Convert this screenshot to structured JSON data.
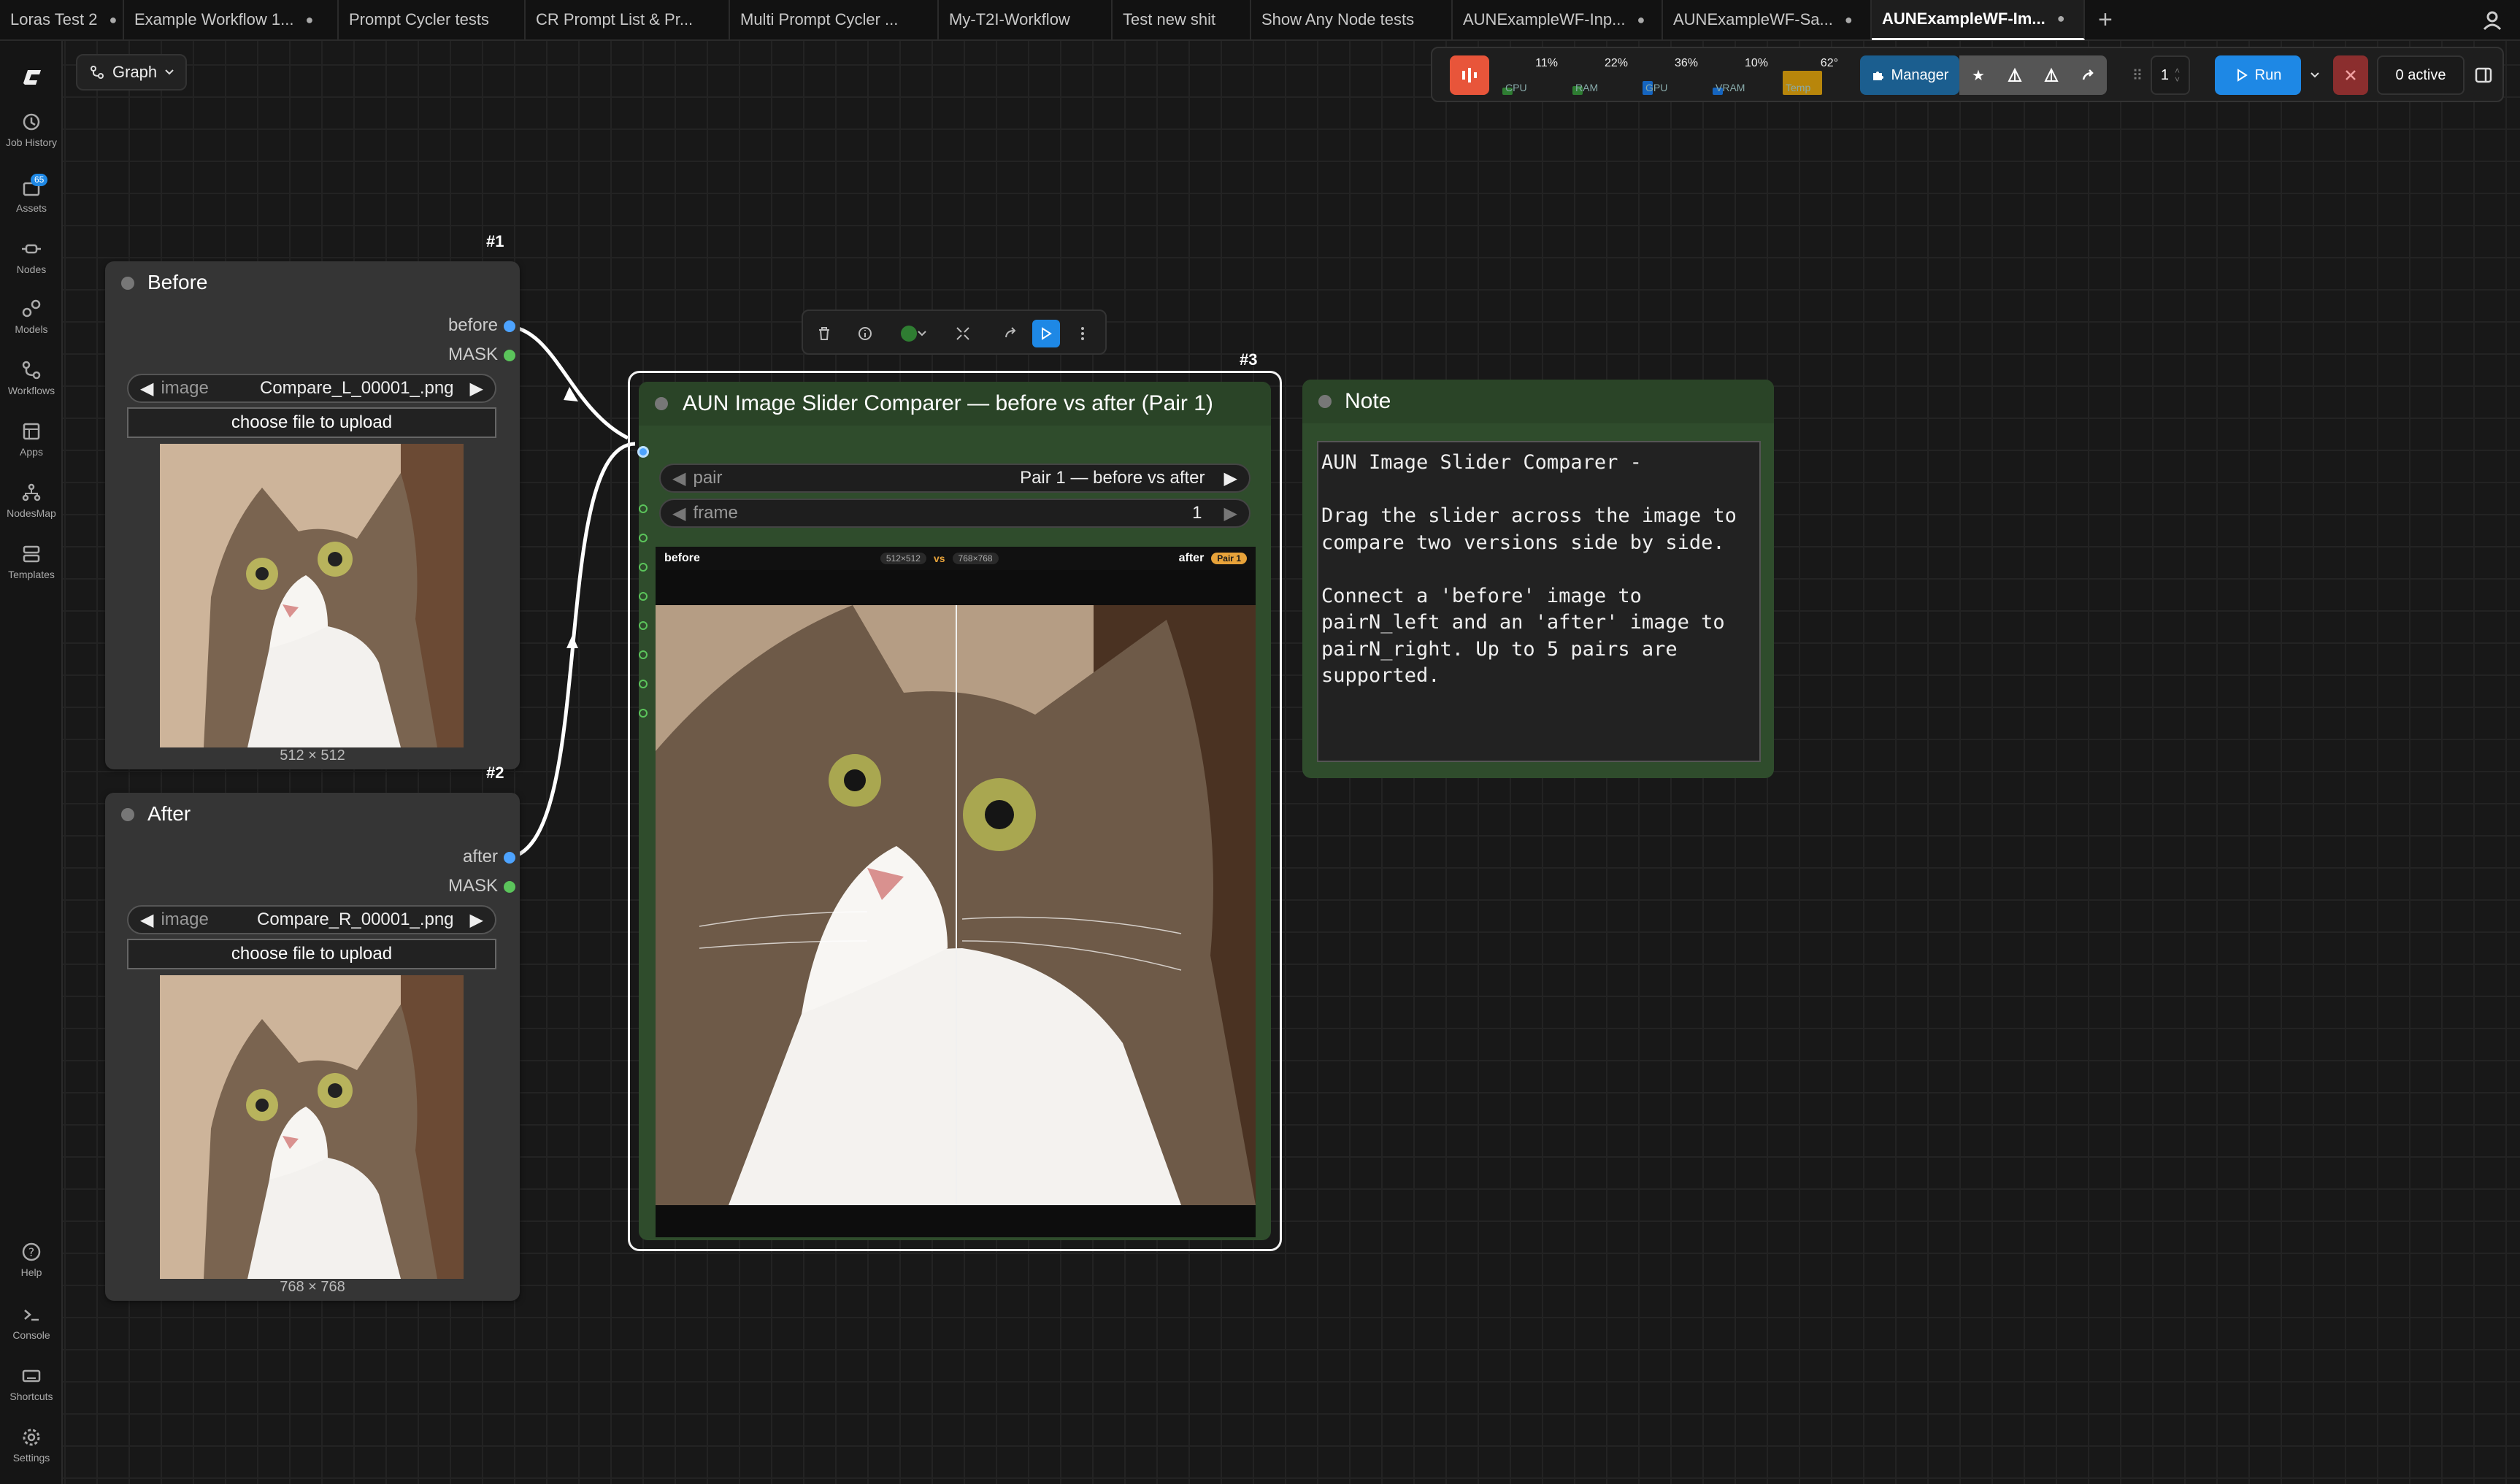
{
  "tabs": [
    {
      "label": "Loras Test 2",
      "dot": "●"
    },
    {
      "label": "Example Workflow 1...",
      "dot": "●"
    },
    {
      "label": "Prompt Cycler tests",
      "dot": ""
    },
    {
      "label": "CR Prompt List & Pr...",
      "dot": ""
    },
    {
      "label": "Multi Prompt Cycler ...",
      "dot": ""
    },
    {
      "label": "My-T2I-Workflow",
      "dot": ""
    },
    {
      "label": "Test new shit",
      "dot": ""
    },
    {
      "label": "Show Any Node tests",
      "dot": ""
    },
    {
      "label": "AUNExampleWF-Inp...",
      "dot": "●"
    },
    {
      "label": "AUNExampleWF-Sa...",
      "dot": "●"
    },
    {
      "label": "AUNExampleWF-Im...",
      "dot": "●"
    }
  ],
  "sidebar": {
    "items": [
      "Job History",
      "Assets",
      "Nodes",
      "Models",
      "Workflows",
      "Apps",
      "NodesMap",
      "Templates"
    ],
    "assets_badge": "65",
    "bottom": [
      "Help",
      "Console",
      "Shortcuts",
      "Settings"
    ]
  },
  "graph_button": {
    "label": "Graph"
  },
  "toolbar": {
    "meters": [
      {
        "label": "CPU",
        "value": "11%",
        "fraction": 0.11,
        "color": "#2e7d32"
      },
      {
        "label": "RAM",
        "value": "22%",
        "fraction": 0.22,
        "color": "#2e7d32"
      },
      {
        "label": "GPU",
        "value": "36%",
        "fraction": 0.36,
        "color": "#1565c0"
      },
      {
        "label": "VRAM",
        "value": "10%",
        "fraction": 0.1,
        "color": "#1565c0"
      },
      {
        "label": "Temp",
        "value": "62°",
        "fraction": 0.62,
        "color": "#b8860b"
      }
    ],
    "manager_label": "Manager",
    "queue_count": "1",
    "run_label": "Run",
    "active_label": "0 active"
  },
  "nodes": {
    "before": {
      "id": "#1",
      "title": "Before",
      "outputs": [
        "before",
        "MASK"
      ],
      "widget_label": "image",
      "widget_value": "Compare_L_00001_.png",
      "upload_label": "choose file to upload",
      "size": "512 × 512"
    },
    "after": {
      "id": "#2",
      "title": "After",
      "outputs": [
        "after",
        "MASK"
      ],
      "widget_label": "image",
      "widget_value": "Compare_R_00001_.png",
      "upload_label": "choose file to upload",
      "size": "768 × 768"
    },
    "comparer": {
      "id": "#3",
      "title": "AUN Image Slider Comparer — before vs after (Pair 1)",
      "pair_label": "pair",
      "pair_value": "Pair 1 — before vs after",
      "frame_label": "frame",
      "frame_value": "1",
      "viewer": {
        "left_label": "before",
        "left_size": "512×512",
        "vs": "vs",
        "right_size": "768×768",
        "right_label": "after",
        "pair_badge": "Pair 1",
        "slider_fraction": 0.5
      }
    },
    "note": {
      "title": "Note",
      "text": "AUN Image Slider Comparer -\n\nDrag the slider across the image to\ncompare two versions side by side.\n\nConnect a 'before' image to\npairN_left and an 'after' image to\npairN_right. Up to 5 pairs are\nsupported."
    }
  },
  "colors": {
    "accent": "#1e88e5",
    "manager": "#1b5e8f",
    "node_green": "#2f4c2c",
    "run": "#1e88e5",
    "stop": "#8b2e2e",
    "logo_orange": "#e8553a"
  }
}
